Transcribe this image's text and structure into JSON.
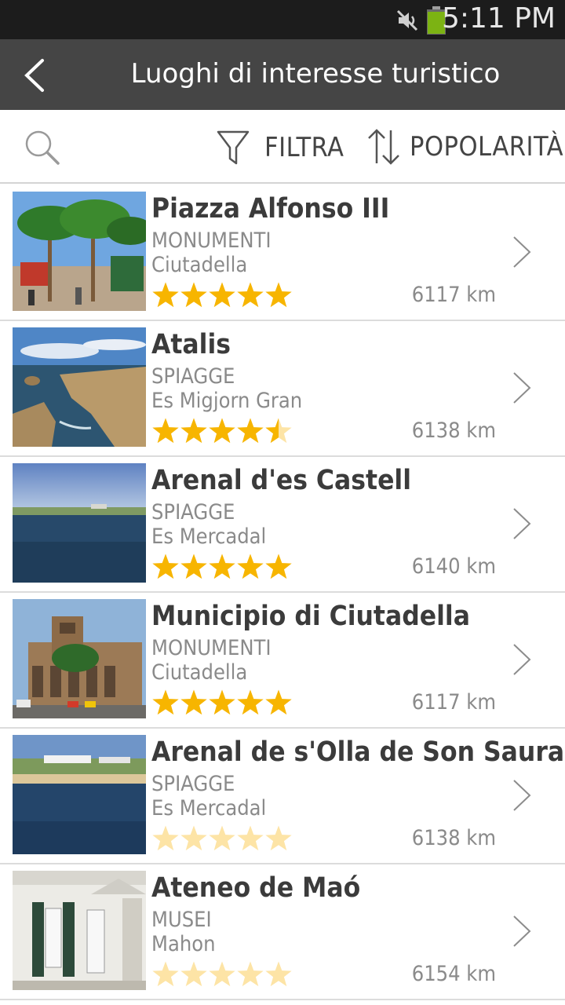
{
  "status_bar": {
    "time": "5:11 PM",
    "icons": [
      "mute-icon",
      "battery-icon"
    ],
    "battery_color": "#8bc34a"
  },
  "header": {
    "title": "Luoghi di interesse turistico",
    "back_icon": "chevron-left-icon",
    "background": "#454545"
  },
  "toolbar": {
    "search_icon": "search-icon",
    "filter_label": "FILTRA",
    "filter_icon": "funnel-icon",
    "sort_label": "POPOLARITÀ",
    "sort_icon": "sort-arrows-icon"
  },
  "accent_star_color": "#f7b500",
  "items": [
    {
      "name": "Piazza Alfonso III",
      "category": "MONUMENTI",
      "town": "Ciutadella",
      "distance": "6117 km",
      "rating": 5,
      "rating_faded": false,
      "thumb": "palm-square"
    },
    {
      "name": "Atalis",
      "category": "SPIAGGE",
      "town": "Es Migjorn Gran",
      "distance": "6138 km",
      "rating": 4.5,
      "rating_faded": false,
      "thumb": "rocky-coast"
    },
    {
      "name": "Arenal d'es Castell",
      "category": "SPIAGGE",
      "town": "Es Mercadal",
      "distance": "6140 km",
      "rating": 5,
      "rating_faded": false,
      "thumb": "bay-horizon"
    },
    {
      "name": "Municipio di Ciutadella",
      "category": "MONUMENTI",
      "town": "Ciutadella",
      "distance": "6117 km",
      "rating": 5,
      "rating_faded": false,
      "thumb": "town-hall"
    },
    {
      "name": "Arenal de s'Olla de Son Saura",
      "category": "SPIAGGE",
      "town": "Es Mercadal",
      "distance": "6138 km",
      "rating": 5,
      "rating_faded": true,
      "thumb": "beach-village"
    },
    {
      "name": "Ateneo de Maó",
      "category": "MUSEI",
      "town": "Mahon",
      "distance": "6154 km",
      "rating": 5,
      "rating_faded": true,
      "thumb": "white-building"
    }
  ]
}
